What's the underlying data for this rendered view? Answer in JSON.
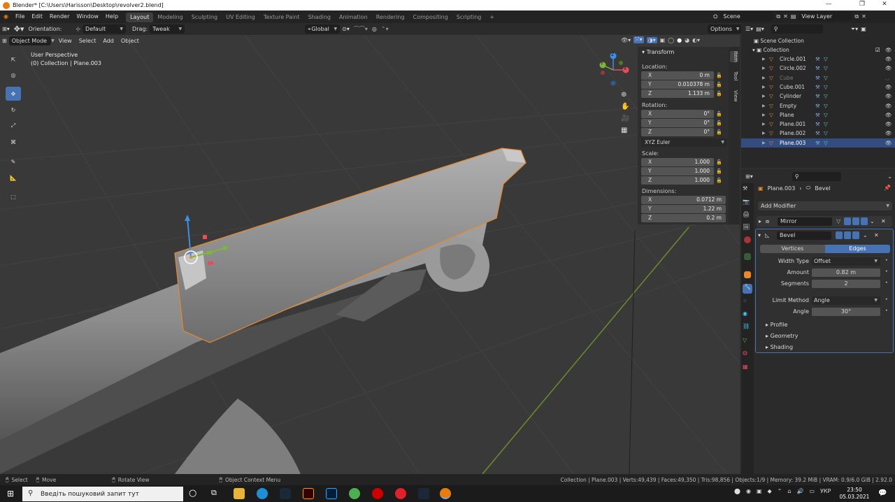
{
  "window": {
    "title": "Blender* [C:\\Users\\Harisson\\Desktop\\revolver2.blend]",
    "controls": [
      "—",
      "❐",
      "✕"
    ]
  },
  "menu": [
    "File",
    "Edit",
    "Render",
    "Window",
    "Help"
  ],
  "workspaces": [
    "Layout",
    "Modeling",
    "Sculpting",
    "UV Editing",
    "Texture Paint",
    "Shading",
    "Animation",
    "Rendering",
    "Compositing",
    "Scripting",
    "+"
  ],
  "scene": {
    "label": "Scene",
    "view_layer": "View Layer"
  },
  "header": {
    "orientation_label": "Orientation:",
    "orientation_value": "Default",
    "drag_label": "Drag:",
    "drag_value": "Tweak",
    "transform_space": "Global",
    "options_label": "Options"
  },
  "viewport_header": {
    "mode": "Object Mode",
    "menus": [
      "View",
      "Select",
      "Add",
      "Object"
    ]
  },
  "overlay_text": {
    "line1": "User Perspective",
    "line2": "(0) Collection | Plane.003"
  },
  "gizmo_axes": {
    "x": "X",
    "y": "Y",
    "z": "Z"
  },
  "n_panel": {
    "title": "Transform",
    "location_label": "Location:",
    "location": [
      {
        "axis": "X",
        "value": "0 m"
      },
      {
        "axis": "Y",
        "value": "0.010378 m"
      },
      {
        "axis": "Z",
        "value": "1.133 m"
      }
    ],
    "rotation_label": "Rotation:",
    "rotation": [
      {
        "axis": "X",
        "value": "0°"
      },
      {
        "axis": "Y",
        "value": "0°"
      },
      {
        "axis": "Z",
        "value": "0°"
      }
    ],
    "rotation_mode": "XYZ Euler",
    "scale_label": "Scale:",
    "scale": [
      {
        "axis": "X",
        "value": "1.000"
      },
      {
        "axis": "Y",
        "value": "1.000"
      },
      {
        "axis": "Z",
        "value": "1.000"
      }
    ],
    "dimensions_label": "Dimensions:",
    "dimensions": [
      {
        "axis": "X",
        "value": "0.0712 m"
      },
      {
        "axis": "Y",
        "value": "1.22 m"
      },
      {
        "axis": "Z",
        "value": "0.2 m"
      }
    ],
    "tabs": [
      "Item",
      "Tool",
      "View"
    ]
  },
  "outliner": {
    "root": "Scene Collection",
    "collection": "Collection",
    "items": [
      {
        "name": "Circle.001",
        "selected": false,
        "dim": false
      },
      {
        "name": "Circle.002",
        "selected": false,
        "dim": false
      },
      {
        "name": "Cube",
        "selected": false,
        "dim": true
      },
      {
        "name": "Cube.001",
        "selected": false,
        "dim": false
      },
      {
        "name": "Cylinder",
        "selected": false,
        "dim": false
      },
      {
        "name": "Empty",
        "selected": false,
        "dim": false
      },
      {
        "name": "Plane",
        "selected": false,
        "dim": false
      },
      {
        "name": "Plane.001",
        "selected": false,
        "dim": false
      },
      {
        "name": "Plane.002",
        "selected": false,
        "dim": false
      },
      {
        "name": "Plane.003",
        "selected": true,
        "dim": false
      }
    ]
  },
  "properties": {
    "object_name": "Plane.003",
    "modifier_context": "Bevel",
    "add_modifier": "Add Modifier",
    "mirror_name": "Mirror",
    "bevel_name": "Bevel",
    "tab_vertices": "Vertices",
    "tab_edges": "Edges",
    "width_type_label": "Width Type",
    "width_type_value": "Offset",
    "amount_label": "Amount",
    "amount_value": "0.82 m",
    "segments_label": "Segments",
    "segments_value": "2",
    "limit_method_label": "Limit Method",
    "limit_method_value": "Angle",
    "angle_label": "Angle",
    "angle_value": "30°",
    "subpanels": [
      "Profile",
      "Geometry",
      "Shading"
    ]
  },
  "status": {
    "select": "Select",
    "move": "Move",
    "rotate_view": "Rotate View",
    "context_menu": "Object Context Menu",
    "stats": "Collection | Plane.003 | Verts:49,439 | Faces:49,350 | Tris:98,856 | Objects:1/9 | Memory: 39.2 MiB | VRAM: 0.9/6.0 GiB | 2.92.0"
  },
  "taskbar": {
    "search_placeholder": "Введіть пошуковий запит тут",
    "lang": "УКР",
    "time": "23:50",
    "date": "05.03.2021"
  },
  "colors": {
    "selection_orange": "#e8892b",
    "active_blue": "#4772b3",
    "axis_x": "#e84d5e",
    "axis_y": "#7cb835",
    "axis_z": "#3f8fe6"
  }
}
